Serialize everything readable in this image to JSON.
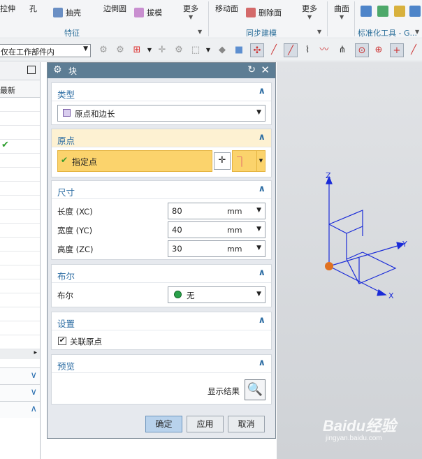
{
  "ribbon": {
    "extrude": "拉伸",
    "hole": "孔",
    "shell": "抽壳",
    "edge_blend": "边倒圆",
    "draft": "拔模",
    "more1": "更多",
    "move_face": "移动面",
    "delete_face": "删除面",
    "more2": "更多",
    "surface": "曲面",
    "group_feature": "特征",
    "group_sync": "同步建模",
    "group_std": "标准化工具 - G..."
  },
  "toolbar": {
    "filter": "仅在工作部件内"
  },
  "navigator": {
    "column": "最新"
  },
  "dialog": {
    "title": "块",
    "type": {
      "header": "类型",
      "value": "原点和边长"
    },
    "origin": {
      "header": "原点",
      "specify_point": "指定点"
    },
    "dimensions": {
      "header": "尺寸",
      "length_label": "长度 (XC)",
      "length_value": "80",
      "width_label": "宽度 (YC)",
      "width_value": "40",
      "height_label": "高度 (ZC)",
      "height_value": "30",
      "unit": "mm"
    },
    "boolean": {
      "header": "布尔",
      "label": "布尔",
      "value": "无"
    },
    "settings": {
      "header": "设置",
      "associative_origin": "关联原点"
    },
    "preview": {
      "header": "预览",
      "show_result": "显示结果"
    },
    "buttons": {
      "ok": "确定",
      "apply": "应用",
      "cancel": "取消"
    }
  },
  "viewport": {
    "axis_x": "X",
    "axis_y": "Y",
    "axis_z": "Z"
  },
  "watermark": {
    "brand": "Baidu经验",
    "url": "jingyan.baidu.com"
  }
}
